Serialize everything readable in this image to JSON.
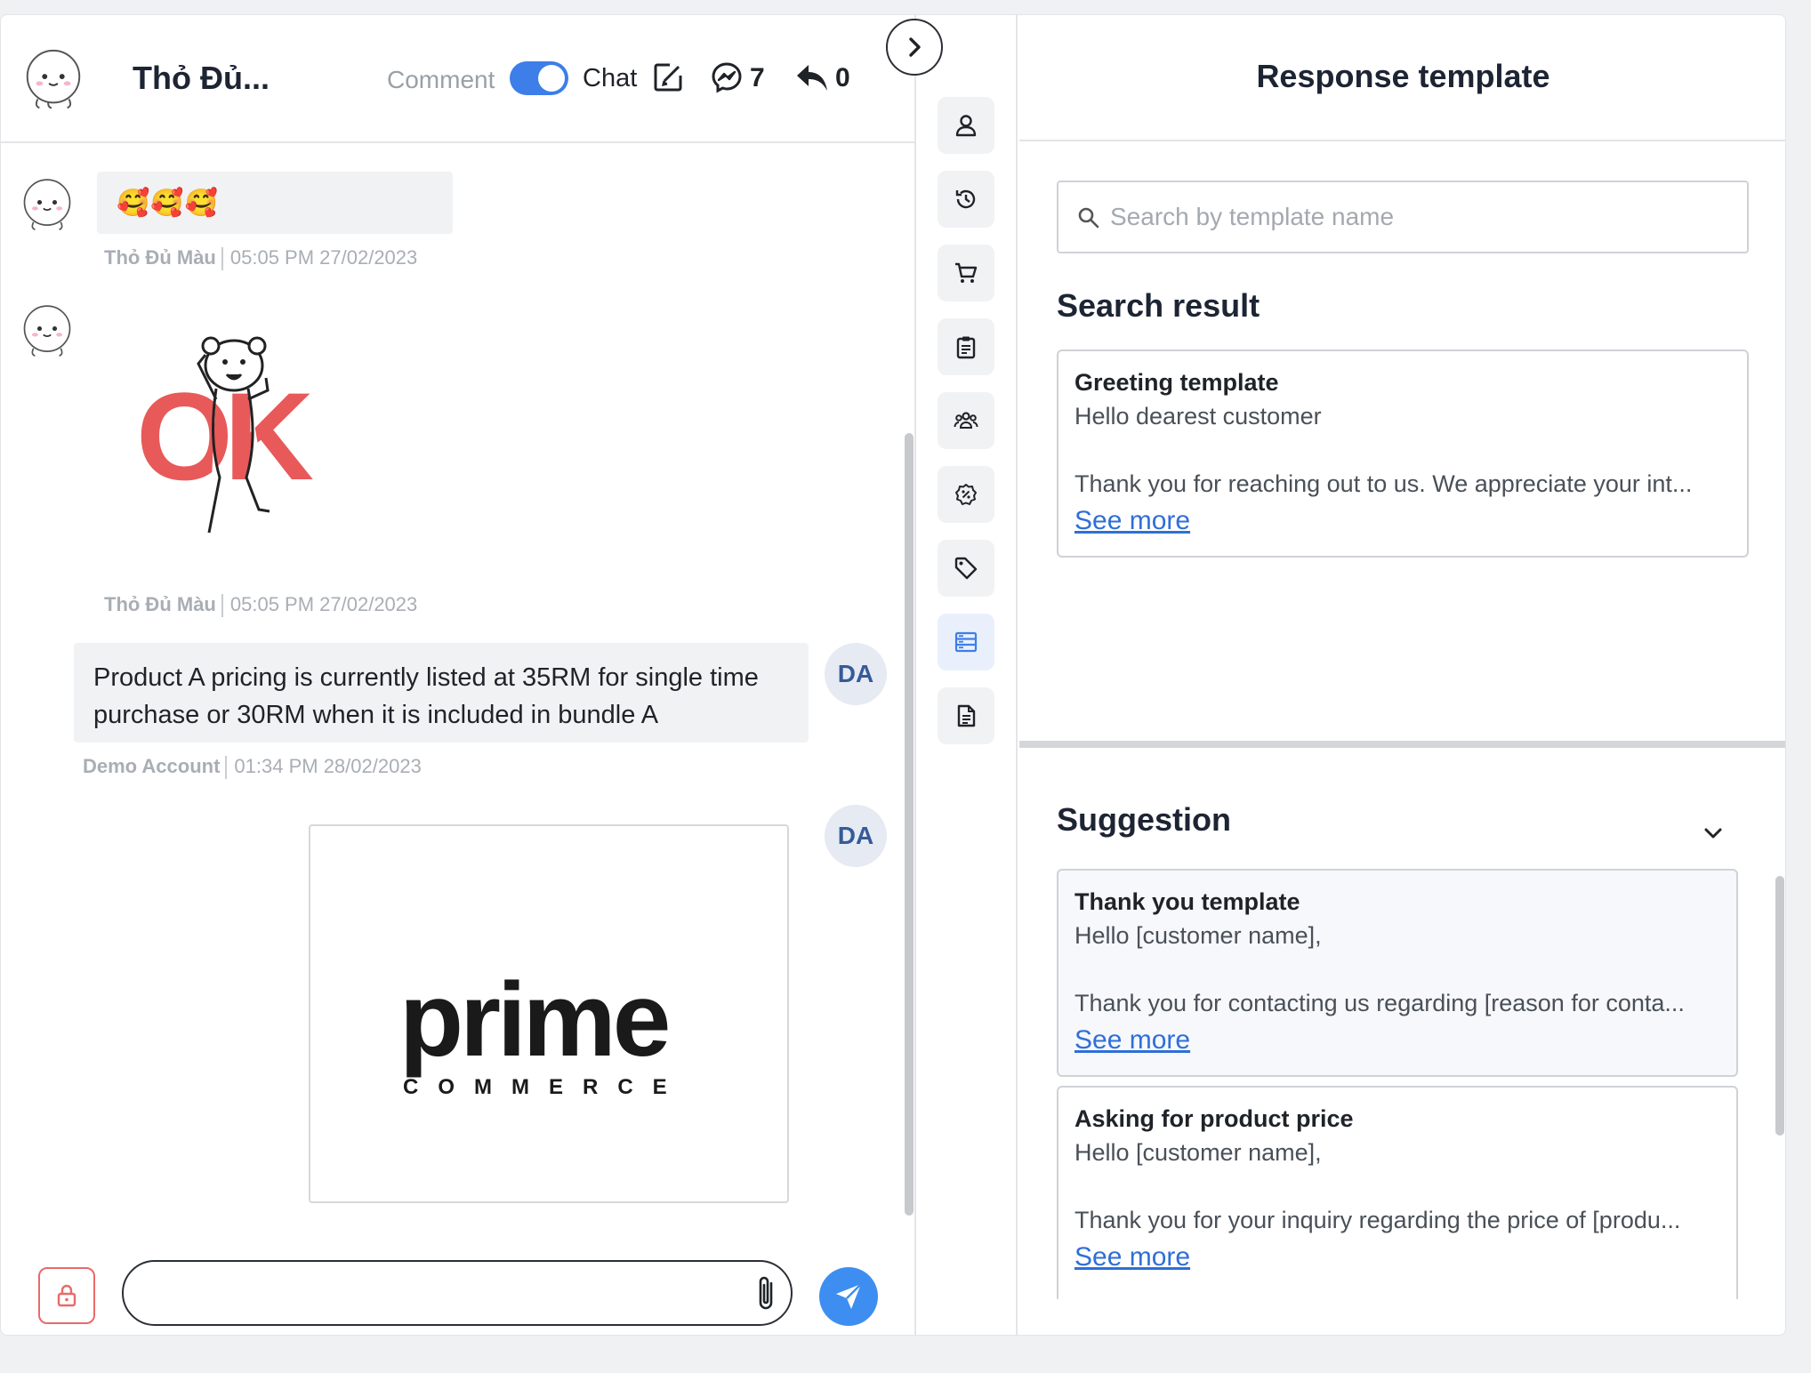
{
  "chat": {
    "contact_name": "Thỏ Đủ...",
    "mode_comment": "Comment",
    "mode_chat": "Chat",
    "messenger_count": "7",
    "reply_count": "0"
  },
  "messages": [
    {
      "sender": "Thỏ Đủ Màu",
      "time": "05:05 PM 27/02/2023",
      "content": "🥰🥰🥰"
    },
    {
      "sender": "Thỏ Đủ Màu",
      "time": "05:05 PM 27/02/2023",
      "content": "OK"
    },
    {
      "sender": "Demo Account",
      "time": "01:34 PM 28/02/2023",
      "avatar": "DA",
      "content": "Product A pricing is currently listed at 35RM for single time purchase or 30RM when it is included in bundle A"
    },
    {
      "avatar": "DA",
      "logo_main": "prime",
      "logo_sub": "COMMERCE"
    }
  ],
  "composer": {
    "value": "",
    "placeholder": ""
  },
  "rail": {
    "items": [
      "user-icon",
      "history-icon",
      "cart-icon",
      "clipboard-icon",
      "group-icon",
      "discount-icon",
      "tag-icon",
      "template-icon",
      "document-icon"
    ],
    "active": "template-icon"
  },
  "panel": {
    "title": "Response template",
    "search_placeholder": "Search by template name",
    "search_value": "",
    "result_title": "Search result",
    "suggestion_title": "Suggestion",
    "see_more": "See more",
    "results": [
      {
        "name": "Greeting template",
        "line1": "Hello dearest customer",
        "line2": "Thank you for reaching out to us. We appreciate your int..."
      }
    ],
    "suggestions": [
      {
        "name": "Thank you template",
        "line1": "Hello [customer name],",
        "line2": "Thank you for contacting us regarding [reason for conta..."
      },
      {
        "name": "Asking for product price",
        "line1": "Hello [customer name],",
        "line2": "Thank you for your inquiry regarding the price of [produ..."
      }
    ]
  },
  "colors": {
    "accent": "#3d7ee8",
    "link": "#2f6fd6",
    "lock": "#e86a6a",
    "sticker_red": "#e8595a"
  }
}
